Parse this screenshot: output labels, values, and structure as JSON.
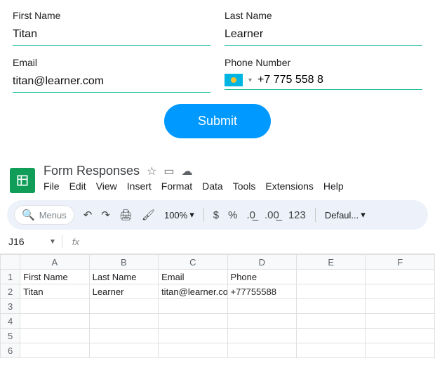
{
  "form": {
    "first_name_label": "First Name",
    "first_name_value": "Titan",
    "last_name_label": "Last Name",
    "last_name_value": "Learner",
    "email_label": "Email",
    "email_value": "titan@learner.com",
    "phone_label": "Phone Number",
    "phone_value": "+7 775 558 8",
    "submit_label": "Submit"
  },
  "sheets": {
    "title": "Form Responses",
    "menus": [
      "File",
      "Edit",
      "View",
      "Insert",
      "Format",
      "Data",
      "Tools",
      "Extensions",
      "Help"
    ],
    "search_placeholder": "Menus",
    "zoom": "100%",
    "font": "Defaul...",
    "namebox": "J16",
    "columns": [
      "A",
      "B",
      "C",
      "D",
      "E",
      "F"
    ],
    "rows": {
      "1": [
        "First Name",
        "Last Name",
        "Email",
        "Phone",
        "",
        ""
      ],
      "2": [
        "Titan",
        "Learner",
        "titan@learner.com",
        "+77755588",
        "",
        ""
      ],
      "3": [
        "",
        "",
        "",
        "",
        "",
        ""
      ],
      "4": [
        "",
        "",
        "",
        "",
        "",
        ""
      ],
      "5": [
        "",
        "",
        "",
        "",
        "",
        ""
      ],
      "6": [
        "",
        "",
        "",
        "",
        "",
        ""
      ]
    }
  },
  "toolbar": {
    "currency": "$",
    "percent": "%",
    "dec_dec": ".0",
    "dec_inc": ".00",
    "num123": "123"
  }
}
